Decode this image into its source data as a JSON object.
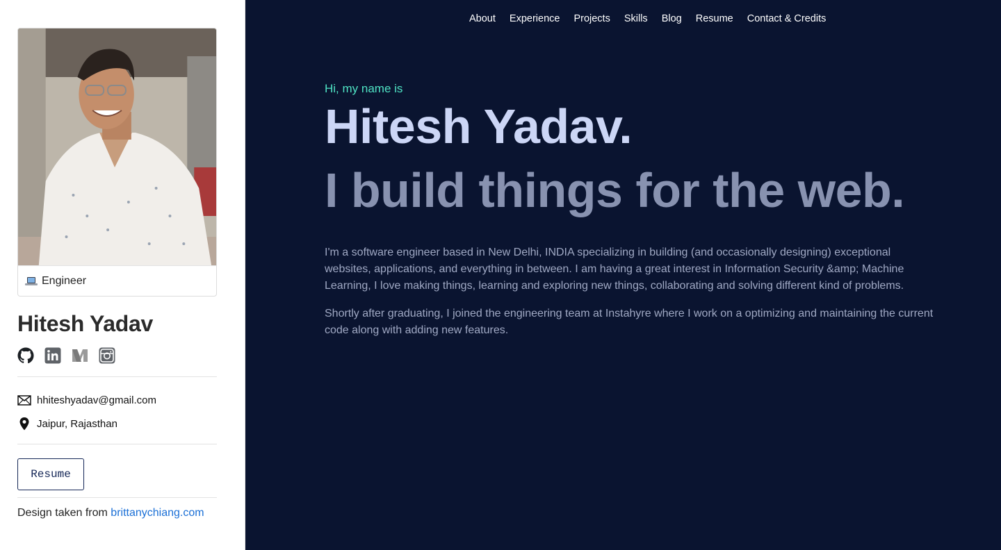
{
  "sidebar": {
    "card_caption_icon": "laptop-icon",
    "card_caption": "Engineer",
    "name": "Hitesh Yadav",
    "socials": [
      {
        "icon": "github-icon"
      },
      {
        "icon": "linkedin-icon"
      },
      {
        "icon": "medium-icon"
      },
      {
        "icon": "instagram-icon"
      }
    ],
    "email": "hhiteshyadav@gmail.com",
    "location": "Jaipur, Rajasthan",
    "resume_button": "Resume",
    "credit_text": "Design taken from",
    "credit_link": "brittanychiang.com"
  },
  "nav": {
    "items": [
      "About",
      "Experience",
      "Projects",
      "Skills",
      "Blog",
      "Resume",
      "Contact & Credits"
    ]
  },
  "hero": {
    "greeting": "Hi, my name is",
    "name": "Hitesh Yadav.",
    "tagline": "I build things for the web.",
    "paragraph1": "I'm a software engineer based in New Delhi, INDIA specializing in building (and occasionally designing) exceptional websites, applications, and everything in between. I am having a great interest in Information Security &amp; Machine Learning, I love making things, learning and exploring new things, collaborating and solving different kind of problems.",
    "paragraph2": "Shortly after graduating, I joined the engineering team at Instahyre where I work on a optimizing and maintaining the current code along with adding new features."
  },
  "colors": {
    "main_bg": "#0a1430",
    "accent": "#4fe3c4",
    "heading": "#ccd6f6",
    "subheading": "#8892b0",
    "link": "#1a6fd6"
  }
}
